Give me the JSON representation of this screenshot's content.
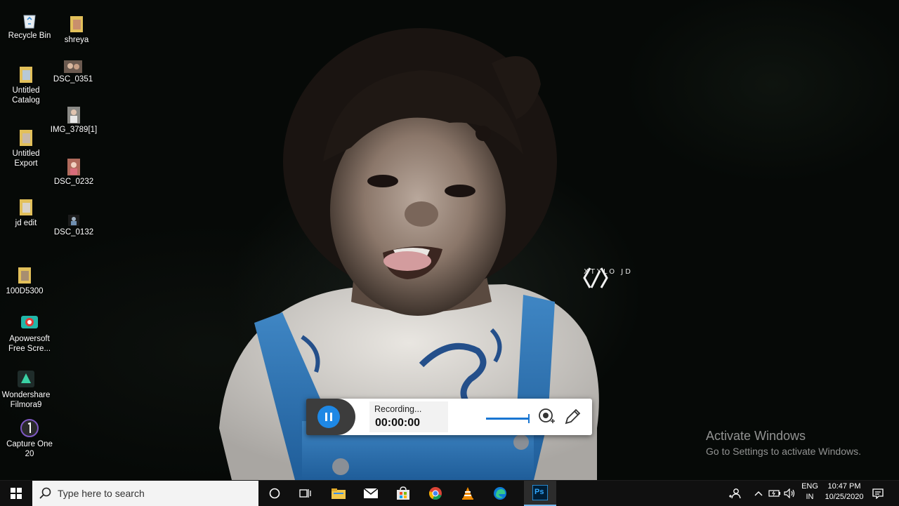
{
  "desktop": {
    "column1": [
      {
        "label_lines": [
          "Recycle Bin"
        ],
        "icon": "recycle-bin-icon"
      },
      {
        "label_lines": [
          "Untitled",
          "Catalog"
        ],
        "icon": "folder-icon"
      },
      {
        "label_lines": [
          "Untitled",
          "Export"
        ],
        "icon": "folder-icon"
      },
      {
        "label_lines": [
          "jd edit"
        ],
        "icon": "folder-icon"
      },
      {
        "label_lines": [
          "100D5300"
        ],
        "icon": "folder-icon"
      },
      {
        "label_lines": [
          "Apowersoft",
          "Free Scre..."
        ],
        "icon": "apowersoft-recorder-icon"
      },
      {
        "label_lines": [
          "Wondershare",
          "Filmora9"
        ],
        "icon": "filmora-icon"
      },
      {
        "label_lines": [
          "Capture One",
          "20"
        ],
        "icon": "capture-one-icon"
      }
    ],
    "column2": [
      {
        "label_lines": [
          "shreya"
        ],
        "icon": "folder-icon"
      },
      {
        "label_lines": [
          "DSC_0351"
        ],
        "icon": "image-thumbnail-icon"
      },
      {
        "label_lines": [
          "IMG_3789[1]"
        ],
        "icon": "image-thumbnail-icon"
      },
      {
        "label_lines": [
          "DSC_0232"
        ],
        "icon": "image-thumbnail-icon"
      },
      {
        "label_lines": [
          "DSC_0132"
        ],
        "icon": "image-thumbnail-icon"
      }
    ]
  },
  "watermark": {
    "text": "XTYLO JD"
  },
  "activation": {
    "title": "Activate Windows",
    "subtitle": "Go to Settings to activate Windows."
  },
  "recorder": {
    "status": "Recording...",
    "elapsed": "00:00:00",
    "volume_level": 1.0,
    "accent": "#1e88e5"
  },
  "taskbar": {
    "search_placeholder": "Type here to search",
    "apps": [
      "start-icon",
      "cortana-icon",
      "task-view-icon",
      "file-explorer-icon",
      "mail-icon",
      "store-icon",
      "chrome-icon",
      "vlc-icon",
      "edge-icon",
      "photoshop-icon"
    ],
    "photoshop_label": "Ps",
    "tray": {
      "language": "ENG",
      "region": "IN",
      "time": "10:47 PM",
      "date": "10/25/2020"
    }
  }
}
